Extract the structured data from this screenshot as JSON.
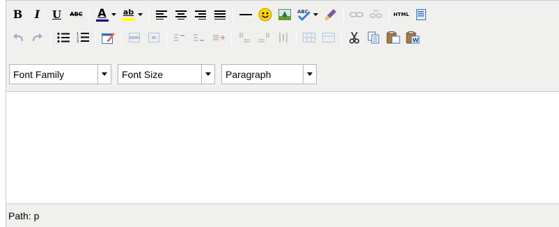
{
  "toolbar": {
    "row1": [
      {
        "name": "bold-button",
        "label": "B",
        "tip": "Bold"
      },
      {
        "name": "italic-button",
        "label": "I",
        "tip": "Italic"
      },
      {
        "name": "underline-button",
        "label": "U",
        "tip": "Underline"
      },
      {
        "name": "strikethrough-button",
        "label": "ABC",
        "tip": "Strikethrough"
      },
      {
        "name": "forecolor-button",
        "label": "A",
        "tip": "Select text color"
      },
      {
        "name": "backcolor-button",
        "label": "ab",
        "tip": "Select background color"
      }
    ],
    "html_button_label": "HTML",
    "colors": {
      "forecolor_bar": "#000080",
      "backcolor_bar": "#ffff00",
      "smiley": "#ffd400",
      "link_gray": "#b0b0b0"
    }
  },
  "selects": {
    "font_family": "Font Family",
    "font_size": "Font Size",
    "format": "Paragraph"
  },
  "statusbar": {
    "path_label": "Path: p"
  },
  "icons": [
    "bold-icon",
    "italic-icon",
    "underline-icon",
    "strikethrough-icon",
    "forecolor-icon",
    "backcolor-icon",
    "justify-left-icon",
    "justify-center-icon",
    "justify-right-icon",
    "justify-full-icon",
    "horizontal-rule-icon",
    "smiley-icon",
    "image-icon",
    "spellcheck-icon",
    "cleanup-icon",
    "link-icon",
    "unlink-icon",
    "html-source-icon",
    "undo-icon",
    "redo-icon",
    "bullet-list-icon",
    "numbered-list-icon",
    "edit-icon",
    "table-icon",
    "cut-icon",
    "copy-icon",
    "paste-icon",
    "paste-word-icon"
  ]
}
